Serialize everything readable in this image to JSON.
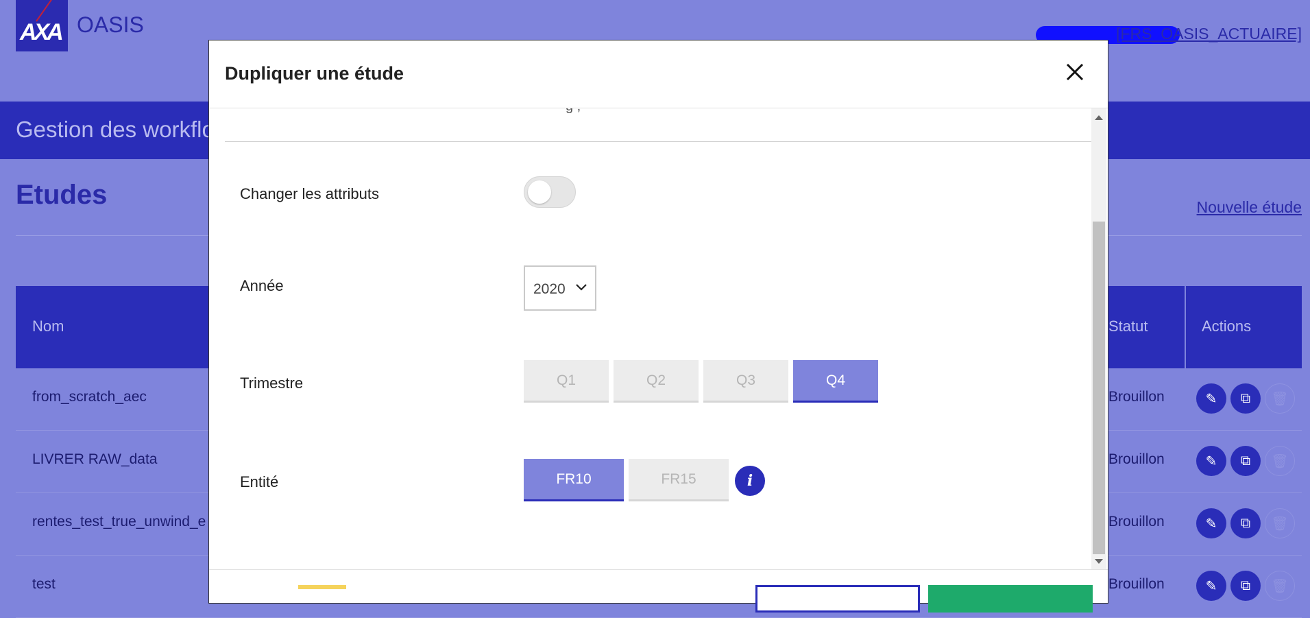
{
  "app": {
    "logo_text": "AXA",
    "name": "OASIS",
    "user_role_link": "[FRS_OASIS_ACTUAIRE]"
  },
  "banner": {
    "title": "Gestion des workflows"
  },
  "page": {
    "heading": "Etudes",
    "new_study_link": "Nouvelle étude"
  },
  "table": {
    "headers": {
      "nom": "Nom",
      "statut": "Statut",
      "actions": "Actions"
    },
    "rows": [
      {
        "nom": "from_scratch_aec",
        "statut": "Brouillon"
      },
      {
        "nom": "LIVRER RAW_data",
        "statut": "Brouillon"
      },
      {
        "nom": "rentes_test_true_unwind_e",
        "statut": "Brouillon"
      },
      {
        "nom": "test",
        "statut": "Brouillon"
      }
    ],
    "action_icons": [
      "pencil-icon",
      "copy-icon",
      "trash-icon"
    ]
  },
  "modal": {
    "title": "Dupliquer une étude",
    "cut_off_text": "g          ,",
    "fields": {
      "changer_attributs": {
        "label": "Changer les attributs",
        "enabled": false
      },
      "annee": {
        "label": "Année",
        "value": "2020"
      },
      "trimestre": {
        "label": "Trimestre",
        "options": [
          "Q1",
          "Q2",
          "Q3",
          "Q4"
        ],
        "selected": "Q4"
      },
      "entite": {
        "label": "Entité",
        "options": [
          "FR10",
          "FR15"
        ],
        "selected": "FR10",
        "info_label": "i"
      }
    }
  },
  "colors": {
    "overlay": "#7f84dc",
    "primary": "#2a2db8",
    "confirm": "#1eaa6b"
  }
}
